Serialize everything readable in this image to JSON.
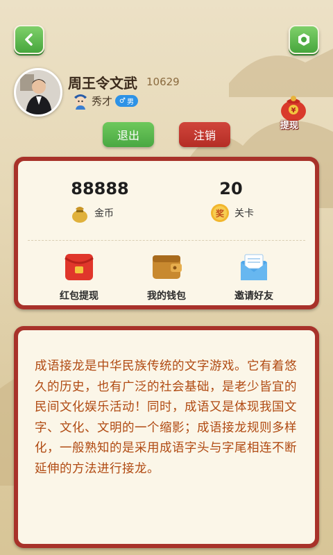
{
  "profile": {
    "name": "周王令文武",
    "uid": "10629",
    "rank": "秀才",
    "gender_symbol": "♂",
    "gender_label": "男"
  },
  "header": {
    "back_icon": "chevron-left-icon",
    "settings_icon": "hexagon-nut-icon",
    "withdraw_label": "提现",
    "withdraw_symbol": "¥"
  },
  "buttons": {
    "exit": "退出",
    "logout": "注销"
  },
  "stats": {
    "coins_value": "88888",
    "coins_label": "金币",
    "level_value": "20",
    "level_label": "关卡",
    "level_badge": "奖"
  },
  "actions": [
    {
      "label": "红包提现",
      "icon": "red-envelope-icon"
    },
    {
      "label": "我的钱包",
      "icon": "wallet-icon"
    },
    {
      "label": "邀请好友",
      "icon": "envelope-invite-icon"
    }
  ],
  "description": "成语接龙是中华民族传统的文字游戏。它有着悠久的历史，也有广泛的社会基础，是老少皆宜的民间文化娱乐活动！同时，成语又是体现我国文字、文化、文明的一个缩影；成语接龙规则多样化，一般熟知的是采用成语字头与字尾相连不断延伸的方法进行接龙。",
  "colors": {
    "panel_border": "#a8322a",
    "green": "#4aa842",
    "red": "#b42d25",
    "text_brown": "#b04a12"
  }
}
